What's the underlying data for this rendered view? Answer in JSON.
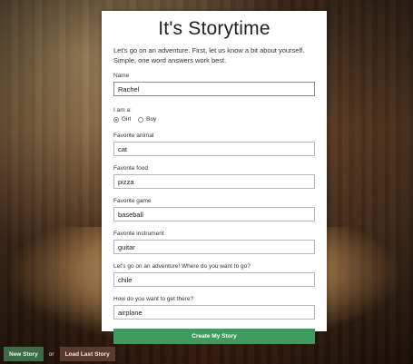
{
  "page": {
    "title": "It's Storytime",
    "intro": "Let's go on an adventure. First, let us know a bit about yourself. Simple, one word answers work best."
  },
  "form": {
    "name": {
      "label": "Name",
      "value": "Rachel"
    },
    "gender": {
      "label": "I am a:",
      "options": [
        "Girl",
        "Boy"
      ],
      "selected": "Girl"
    },
    "animal": {
      "label": "Favorite animal",
      "value": "cat"
    },
    "food": {
      "label": "Favorite food",
      "value": "pizza"
    },
    "game": {
      "label": "Favorite game",
      "value": "baseball"
    },
    "instrument": {
      "label": "Favorite instrument",
      "value": "guitar"
    },
    "destination": {
      "label": "Let's go on an adventure! Where do you want to go?",
      "value": "chile"
    },
    "transport": {
      "label": "How do you want to get there?",
      "value": "airplane"
    },
    "submit_label": "Create My Story"
  },
  "footer": {
    "new_label": "New Story",
    "or_label": "or",
    "load_label": "Load Last Story"
  },
  "colors": {
    "accent": "#3e9a5f",
    "new_button": "#3e6b45",
    "load_button": "#5a3a2a"
  }
}
